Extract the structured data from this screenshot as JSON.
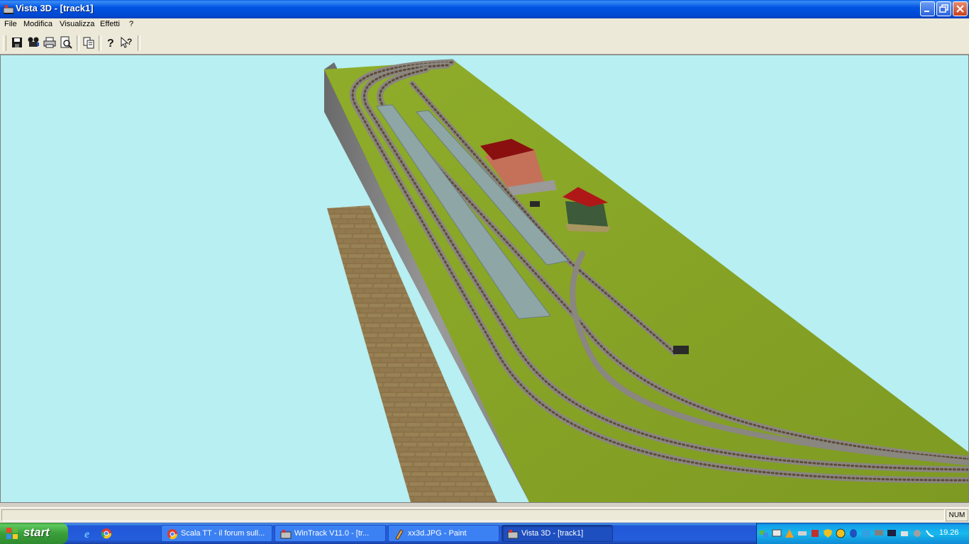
{
  "window": {
    "title": "Vista 3D - [track1]"
  },
  "menu": [
    "File",
    "Modifica",
    "Visualizza",
    "Effetti",
    "?"
  ],
  "toolbar": {
    "tools": [
      "save-icon",
      "camera-icon",
      "print-icon",
      "print-preview-icon",
      "copy-icon",
      "help-icon",
      "context-help-icon"
    ]
  },
  "status": {
    "num": "NUM"
  },
  "taskbar": {
    "start_label": "start",
    "tasks": [
      {
        "label": "Scala TT - il forum sull...",
        "icon": "chrome-icon"
      },
      {
        "label": "WinTrack  V11.0 - [tr...",
        "icon": "wintrack-icon"
      },
      {
        "label": "xx3d.JPG - Paint",
        "icon": "paint-icon"
      },
      {
        "label": "Vista 3D - [track1]",
        "icon": "vista3d-icon"
      }
    ],
    "clock": "19.26"
  },
  "colors": {
    "sky": "#b7eff2",
    "grass": "#8aa628",
    "cliff": "#8a8a8a",
    "brick": "#8b7348",
    "track": "#8a8680",
    "platform": "#8fa6a6",
    "roof": "#8a1010",
    "building": "#c5715a"
  }
}
